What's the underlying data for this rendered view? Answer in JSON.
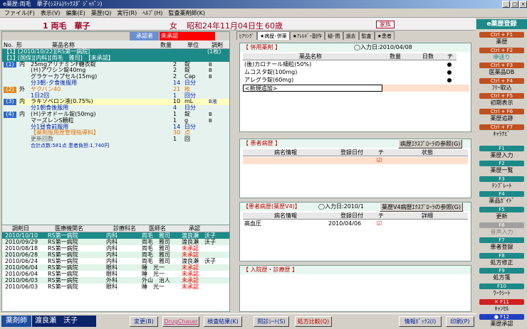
{
  "window": {
    "title": "e薬歴:両毛　華子(ｼｽﾃﾑ)ﾘｯｸｽﾀﾞ ｼﾞｬﾊﾟﾝ)"
  },
  "menu": [
    "ファイル(F)",
    "表示(V)",
    "編集(E)",
    "薬歴(Q)",
    "実行(R)",
    "ﾍﾙﾌﾟ(H)",
    "監査薬剤師(K)"
  ],
  "patient": {
    "name": "1 両毛　華子",
    "sex": "女",
    "dob": "昭和24年11月04日生",
    "age": "60歳",
    "family": "家族"
  },
  "left": {
    "cols": [
      "No.",
      "形",
      "薬品名称",
      "数量",
      "単位",
      "調剤"
    ],
    "approver_label": "承認者",
    "approval_status": "未承認",
    "rows": [
      {
        "c1": "【1】",
        "name": "[2010/10/22][RS第一病院]",
        "qty": "(1枚)",
        "style": "teal"
      },
      {
        "c1": "【1】",
        "name": "[国保][内科][両毛　雅司]　【未承認】",
        "style": "teal"
      },
      {
        "c1": "(1)",
        "form": "内",
        "name": "25mgアリナミンF糖衣錠",
        "qty": "2",
        "unit": "錠",
        "disp": "B",
        "num": "blue"
      },
      {
        "name": "(Ｈ)アワシン錠40mg",
        "qty": "2",
        "unit": "錠",
        "disp": "B"
      },
      {
        "name": "グラケーカプセル(15mg)",
        "qty": "2",
        "unit": "Cap",
        "disp": "B"
      },
      {
        "name": "分3朝･夕食後服用",
        "qty": "14",
        "unit": "日分",
        "style": "blue"
      },
      {
        "c1": "(2)",
        "form": "外",
        "name": "ヤクバン40",
        "qty": "21",
        "unit": "枚",
        "style": "orange",
        "num": "orange"
      },
      {
        "name": "1日2回",
        "qty": "1",
        "unit": "回分",
        "style": "blue"
      },
      {
        "c1": "(3)",
        "form": "内",
        "name": "ラキソベロン液(0.75%)",
        "qty": "10",
        "unit": "mL",
        "disp": "B液",
        "num": "blue",
        "hl": true
      },
      {
        "name": "分1朝食後服用",
        "qty": "4",
        "unit": "日分",
        "style": "blue"
      },
      {
        "c1": "(4)",
        "form": "内",
        "name": "(Ｈ)テオドール錠(50mg)",
        "qty": "1",
        "unit": "錠",
        "disp": "B",
        "num": "blue"
      },
      {
        "name": "マーズレンS顆粒",
        "qty": "1",
        "unit": "g",
        "disp": "B"
      },
      {
        "name": "分1昼食前服用",
        "qty": "14",
        "unit": "日分",
        "style": "blue"
      },
      {
        "name": "【薬剤服用歴管理指導料】",
        "qty": "30",
        "unit": "点",
        "style": "orange"
      },
      {
        "name": "更新回数",
        "qty": "1",
        "unit": "回",
        "style": "gray"
      },
      {
        "name": "合計点数:581点 患者負担:1,740円",
        "style": "smallblue"
      }
    ]
  },
  "history": {
    "cols": [
      "調剤日",
      "医療機関名",
      "診療科名",
      "医師名",
      "承認"
    ],
    "rows": [
      [
        "2010/10/10",
        "RS第一病院",
        "内科",
        "両毛　雅司",
        "渡良瀬　沃子"
      ],
      [
        "2010/09/29",
        "RS第一病院",
        "内科",
        "両毛　雅司",
        "渡良瀬　沃子"
      ],
      [
        "2010/08/18",
        "RS第一病院",
        "内科",
        "両毛　雅司",
        "未承認"
      ],
      [
        "2010/06/28",
        "RS第一病院",
        "内科",
        "両毛　雅司",
        "未承認"
      ],
      [
        "2010/06/24",
        "RS第一病院",
        "内科",
        "両毛　雅司",
        "渡良瀬　沃子"
      ],
      [
        "2010/06/04",
        "RS第一病院",
        "眼科",
        "睡　光一",
        "未承認"
      ],
      [
        "2010/06/04",
        "RS第一病院",
        "眼科",
        "睡　光一",
        "未承認"
      ],
      [
        "2010/06/03",
        "RS第一病院",
        "外科",
        "外山　治人",
        "未承認"
      ],
      [
        "2010/06/03",
        "RS第一病院",
        "眼科",
        "睡　光一",
        "未承認"
      ]
    ]
  },
  "tabs": [
    "ﾋｱﾘﾝｸﾞ",
    "★病歴･併薬",
    "★ｱﾚﾙｷﾞｰ副作",
    "疑･問",
    "過去",
    "監査",
    "★患者"
  ],
  "concomitant": {
    "title": "【 併用薬剤 】",
    "entry": "◯入力日:2010/04/08",
    "cols": [
      "薬品名称",
      "数量",
      "日数",
      "チ"
    ],
    "rows": [
      "(後)カロナール細粒(50%)",
      "ムコスタ錠(100mg)",
      "アレグラ錠(60mg)"
    ],
    "new": "<新規追加>"
  },
  "disease": {
    "title": "【 患者病歴 】",
    "ref_btn": "病歴ｴｸｽﾌﾟﾛｰﾗの参照(G)",
    "cols": [
      "病名情報",
      "登録日付",
      "チ",
      "状態"
    ]
  },
  "disease2": {
    "title": "【患者病歴(薬歴V4)】",
    "entry": "◯入力日:2010/1",
    "ref_btn": "薬歴V4病歴ｴｸｽﾌﾟﾛｰﾗの参照(G)",
    "cols": [
      "病名情報",
      "登録日付",
      "チ",
      "詳細"
    ],
    "row": {
      "name": "高血圧",
      "date": "2010/04/06"
    }
  },
  "admission": {
    "title": "【 入院歴・診療歴 】"
  },
  "sidebar": {
    "header": "e薬歴登録",
    "buttons": [
      {
        "key": "Ctrl + F1",
        "label": "薬歴",
        "kc": "ko"
      },
      {
        "key": "Ctrl + F2",
        "label": "申送り",
        "kc": "ko",
        "lc": "#1c8a88"
      },
      {
        "key": "Ctrl + F3",
        "label": "医薬品DB",
        "kc": "ko"
      },
      {
        "key": "Ctrl + F4",
        "label": "ﾌﾘｰ取込",
        "kc": "ko"
      },
      {
        "key": "Ctrl + F5",
        "label": "初期表示",
        "kc": "ko"
      },
      {
        "key": "Ctrl + F6",
        "label": "薬歴追跡",
        "kc": "ko"
      },
      {
        "key": "Ctrl + F7",
        "label": "ｷｬﾗﾅﾋﾞ",
        "kc": "ko"
      },
      {
        "key": "F1",
        "label": "薬歴入力",
        "kc": "kg"
      },
      {
        "key": "F2",
        "label": "薬歴一覧",
        "kc": "kg"
      },
      {
        "key": "F3",
        "label": "ﾃﾝﾌﾟﾚｰﾄ",
        "kc": "kg"
      },
      {
        "key": "F4",
        "label": "薬品ｶﾞｲﾄﾞ",
        "kc": "kg"
      },
      {
        "key": "F5",
        "label": "更新",
        "kc": "kg"
      },
      {
        "key": "F6",
        "label": "音声入力",
        "kc": "kgr",
        "lc": "#808080"
      },
      {
        "key": "F7",
        "label": "患者登録",
        "kc": "kg"
      },
      {
        "key": "F8",
        "label": "処方修正",
        "kc": "kg"
      },
      {
        "key": "F9",
        "label": "処方箋",
        "kc": "kg"
      },
      {
        "key": "F10",
        "label": "ﾜｰｸｼｰﾄ",
        "kc": "kg"
      },
      {
        "key": "✕ F11",
        "label": "ｷｬﾝｾﾙ",
        "kc": "kr"
      },
      {
        "key": "● F12",
        "label": "薬歴承認",
        "kc": "kb"
      }
    ]
  },
  "status": {
    "role": "薬剤師",
    "pharmacist": "渡良瀬　沃子",
    "buttons": [
      "変更(B)",
      "DrugChaser",
      "検査結果(K)",
      "問診ｼｰﾄ(S)",
      "処方比較(Q)",
      "情報ﾎﾞｯｸｽ(I)",
      "印刷(P)"
    ]
  }
}
